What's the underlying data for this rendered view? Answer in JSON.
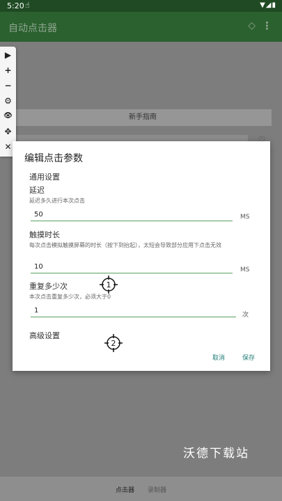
{
  "status_bar": {
    "time": "5:20",
    "hand_icon": "hand-pointer-icon",
    "right_icons": "▼◢▮"
  },
  "app_bar": {
    "title": "自动点击器",
    "gem_icon": "diamond-icon",
    "menu_icon": "more-vert-icon"
  },
  "background": {
    "guide_button": "新手指南"
  },
  "toolbar": {
    "items": [
      "▶",
      "+",
      "−",
      "⚙",
      "👁",
      "✥",
      "✕"
    ]
  },
  "dialog": {
    "title": "编辑点击参数",
    "general_section": "通用设置",
    "delay": {
      "label": "延迟",
      "description": "延迟多久进行本次点击",
      "value": "50",
      "unit": "MS"
    },
    "touch_duration": {
      "label": "触摸时长",
      "description": "每次点击模拟触摸屏幕的时长（按下到抬起），太短会导致部分应用下点击无效",
      "value": "10",
      "unit": "MS"
    },
    "repeat": {
      "label": "重复多少次",
      "description": "本次点击重复多少次，必须大于0",
      "value": "1",
      "unit": "次"
    },
    "advanced_section": "高级设置",
    "cancel_label": "取消",
    "save_label": "保存"
  },
  "targets": [
    "1",
    "2"
  ],
  "bottom_nav": {
    "item1": "点击器",
    "item2": "录制器"
  },
  "watermark": "沃德下载站",
  "colors": {
    "primary_dark": "#1f4a23",
    "primary": "#2b612f",
    "accent": "#26807a",
    "underline": "#5aa05e"
  }
}
